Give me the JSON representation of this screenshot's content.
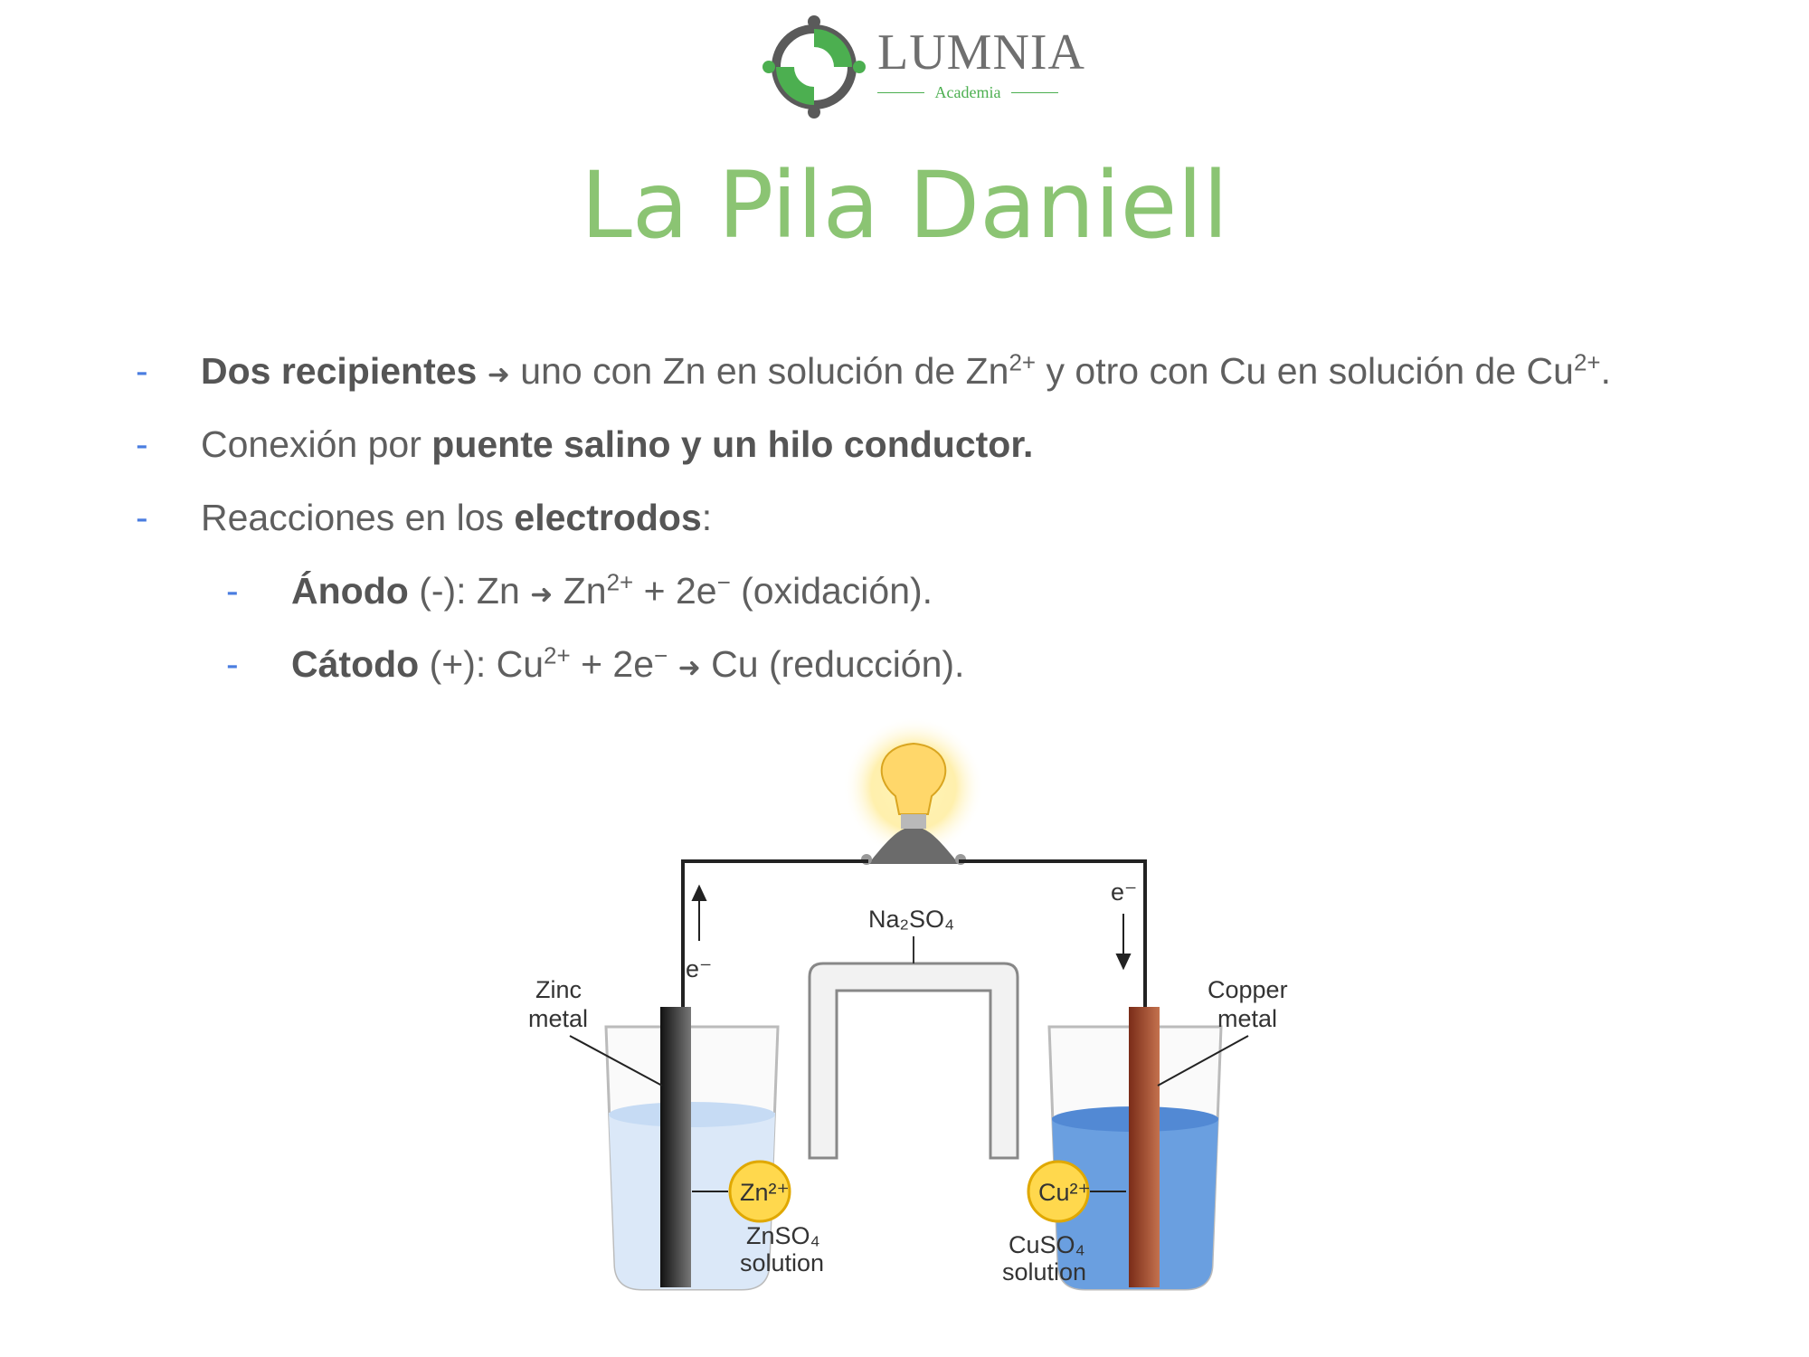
{
  "logo": {
    "name": "LUMNIA",
    "subtitle": "Academia"
  },
  "title": "La Pila Daniell",
  "bullets": [
    {
      "bold": "Dos recipientes",
      "arrow": "➜",
      "text1": " uno con Zn en solución de Zn",
      "sup1": "2+",
      "text2": " y otro con Cu en solución de Cu",
      "sup2": "2+",
      "text3": "."
    },
    {
      "text1": "Conexión por ",
      "bold": "puente salino y un hilo conductor."
    },
    {
      "text1": "Reacciones en los ",
      "bold": "electrodos",
      "text2": ":"
    }
  ],
  "sub_bullets": [
    {
      "bold": "Ánodo",
      "text1": " (-): Zn ",
      "arrow": "➜",
      "text2": " Zn",
      "sup1": "2+",
      "text3": " + 2e",
      "sup2": "−",
      "text4": " (oxidación)."
    },
    {
      "bold": "Cátodo",
      "text1": " (+): Cu",
      "sup1": "2+",
      "text2": " + 2e",
      "sup2": "−",
      "arrow": "➜",
      "text3": " Cu (reducción)."
    }
  ],
  "dash": "-",
  "diagram": {
    "zinc_label_1": "Zinc",
    "zinc_label_2": "metal",
    "copper_label_1": "Copper",
    "copper_label_2": "metal",
    "salt_bridge": "Na₂SO₄",
    "electron_left": "e⁻",
    "electron_right": "e⁻",
    "zn_ion": "Zn²⁺",
    "cu_ion": "Cu²⁺",
    "zn_solution_1": "ZnSO₄",
    "zn_solution_2": "solution",
    "cu_solution_1": "CuSO₄",
    "cu_solution_2": "solution"
  },
  "colors": {
    "title": "#8bc473",
    "dash": "#4a7de0",
    "zinc": "#2b2b2b",
    "copper": "#a0472e",
    "cu_solution": "#6a9fe0",
    "zn_solution": "#dbe8f8"
  }
}
